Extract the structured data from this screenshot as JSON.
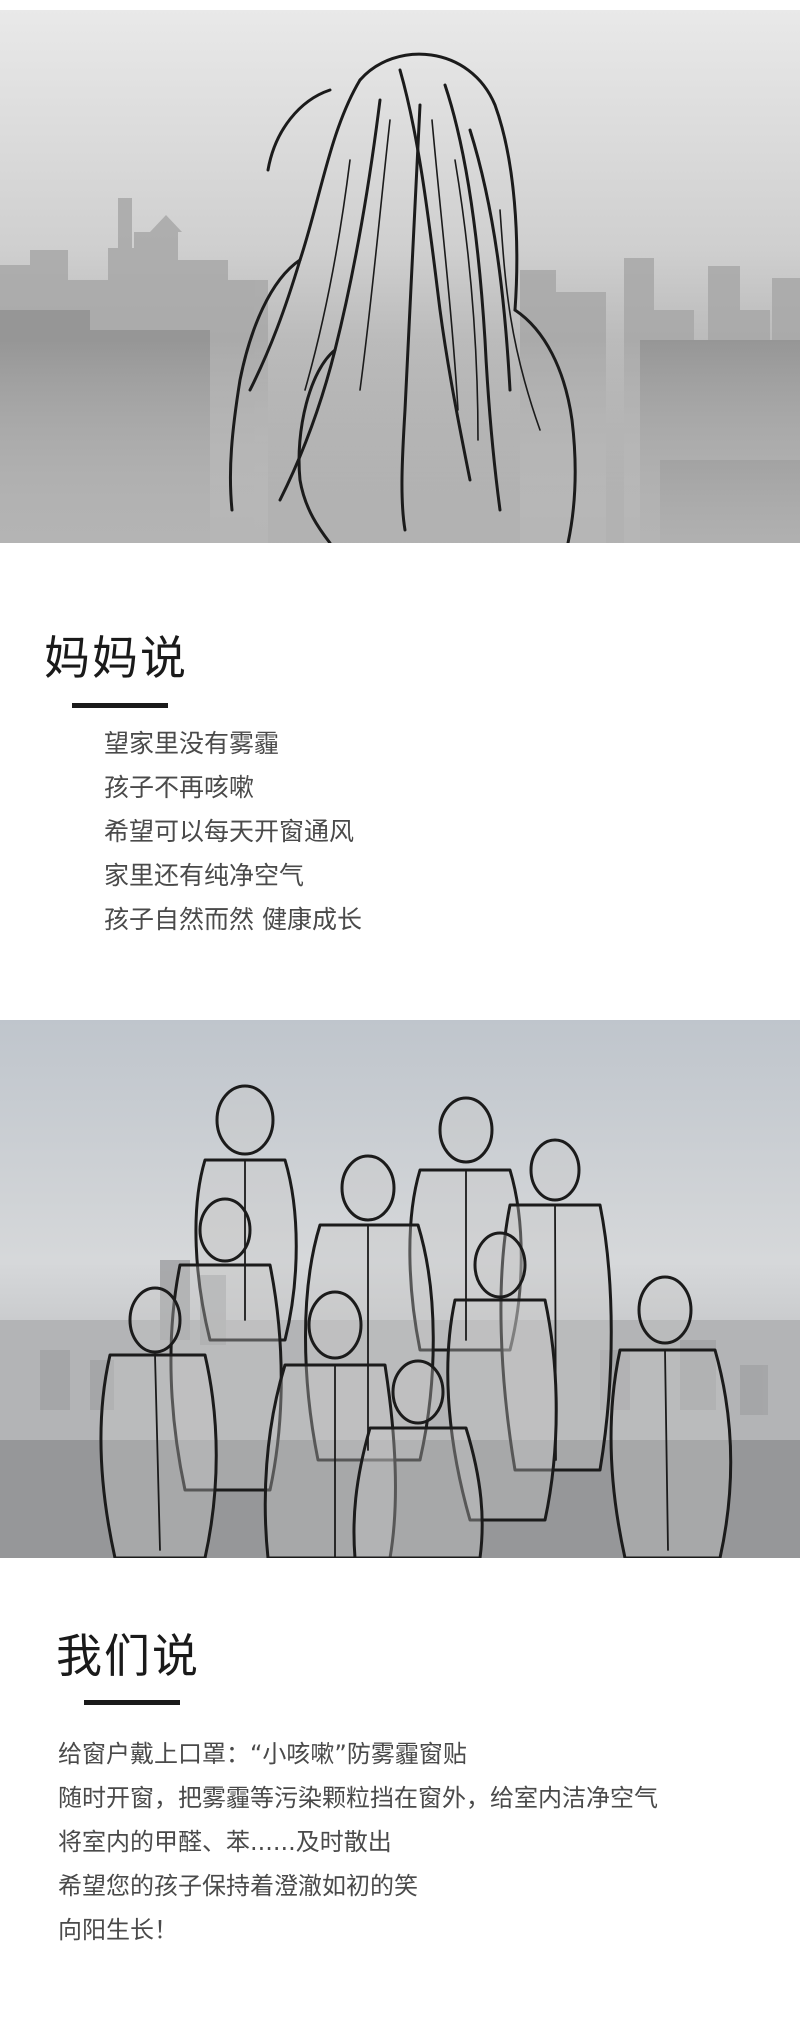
{
  "section_mom": {
    "title": "妈妈说",
    "lines": [
      "望家里没有雾霾",
      "孩子不再咳嗽",
      "希望可以每天开窗通风",
      "家里还有纯净空气",
      "孩子自然而然 健康成长"
    ]
  },
  "section_us": {
    "title": "我们说",
    "lines": [
      "给窗户戴上口罩：“小咳嗽”防雾霾窗贴",
      "随时开窗，把雾霾等污染颗粒挡在窗外，给室内洁净空气",
      "将室内的甲醛、苯......及时散出",
      "希望您的孩子保持着澄澈如初的笑",
      "向阳生长！"
    ]
  },
  "colors": {
    "heading": "#1a1a1a",
    "body_text": "#4a4a4a",
    "haze_light": "#d9d9d9",
    "haze_dark": "#8d8d8d",
    "sky_blue_gray": "#c3c8ce"
  }
}
